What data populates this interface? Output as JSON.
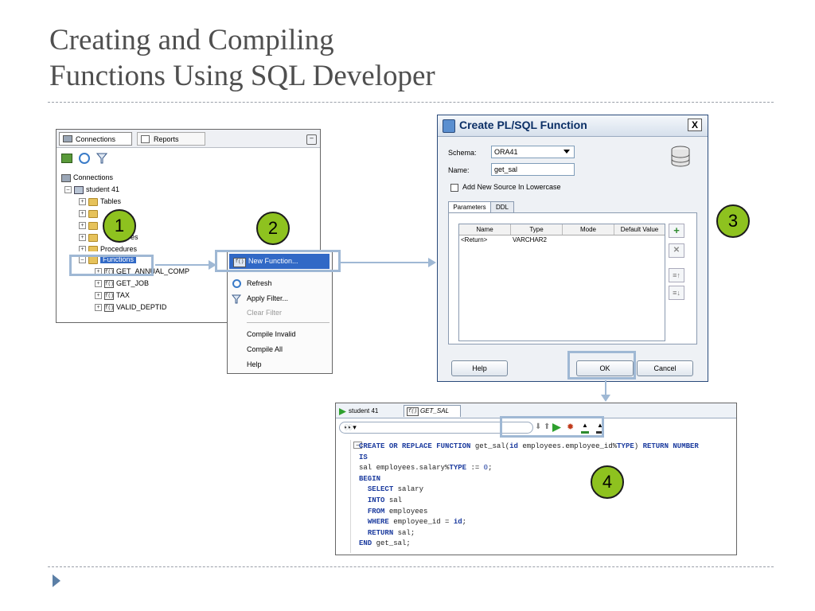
{
  "slide": {
    "title_line1": "Creating and Compiling",
    "title_line2": "Functions Using SQL Developer"
  },
  "callouts": [
    "1",
    "2",
    "3",
    "4"
  ],
  "connections_panel": {
    "tabs": [
      "Connections",
      "Reports"
    ],
    "tree": [
      {
        "label": "Connections",
        "level": 0
      },
      {
        "label": "student 41",
        "level": 1
      },
      {
        "label": "Tables",
        "level": 2
      },
      {
        "label": "",
        "level": 2
      },
      {
        "label": "",
        "level": 2
      },
      {
        "label": "es",
        "level": 2
      },
      {
        "label": "Procedures",
        "level": 2
      },
      {
        "label": "Functions",
        "level": 2,
        "selected": true
      },
      {
        "label": "GET_ANNUAL_COMP",
        "level": 3
      },
      {
        "label": "GET_JOB",
        "level": 3
      },
      {
        "label": "TAX",
        "level": 3
      },
      {
        "label": "VALID_DEPTID",
        "level": 3
      }
    ]
  },
  "context_menu": {
    "items": [
      {
        "label": "New Function...",
        "icon": "function-icon",
        "highlighted": true
      },
      {
        "label": "Refresh",
        "icon": "refresh-icon"
      },
      {
        "label": "Apply Filter...",
        "icon": "filter-icon"
      },
      {
        "label": "Clear Filter",
        "disabled": true
      },
      {
        "label": "Compile Invalid"
      },
      {
        "label": "Compile All"
      },
      {
        "label": "Help"
      }
    ]
  },
  "dialog": {
    "title": "Create PL/SQL Function",
    "close_label": "X",
    "schema_label": "Schema:",
    "schema_value": "ORA41",
    "name_label": "Name:",
    "name_value": "get_sal",
    "lowercase_label": "Add New Source In Lowercase",
    "lowercase_checked": false,
    "tabs": [
      "Parameters",
      "DDL"
    ],
    "columns": [
      "Name",
      "Type",
      "Mode",
      "Default Value"
    ],
    "rows": [
      [
        "<Return>",
        "VARCHAR2",
        "",
        ""
      ]
    ],
    "help_label": "Help",
    "ok_label": "OK",
    "cancel_label": "Cancel"
  },
  "editor": {
    "tabs": [
      "student 41",
      "GET_SAL"
    ],
    "code_lines": [
      "CREATE OR REPLACE FUNCTION get_sal(id employees.employee_id%TYPE) RETURN NUMBER",
      "IS",
      "sal employees.salary%TYPE := 0;",
      "BEGIN",
      "  SELECT salary",
      "  INTO sal",
      "  FROM employees",
      "  WHERE employee_id = id;",
      "  RETURN sal;",
      "END get_sal;"
    ]
  },
  "colors": {
    "callout": "#8ec21f",
    "highlight": "#9fb8d4",
    "title_text": "#4f4f4f",
    "selection": "#3169c6"
  }
}
